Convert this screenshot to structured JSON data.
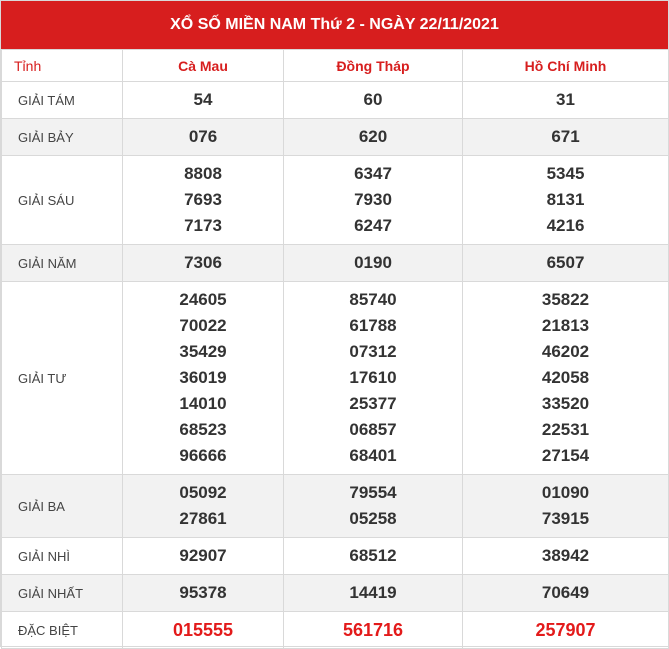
{
  "header": {
    "title": "XỔ SỐ MIỀN NAM Thứ 2 - NGÀY 22/11/2021"
  },
  "table": {
    "corner_label": "Tỉnh",
    "provinces": [
      "Cà Mau",
      "Đồng Tháp",
      "Hồ Chí Minh"
    ],
    "rows": [
      {
        "label": "GIẢI TÁM",
        "values": [
          [
            "54"
          ],
          [
            "60"
          ],
          [
            "31"
          ]
        ]
      },
      {
        "label": "GIẢI BẢY",
        "values": [
          [
            "076"
          ],
          [
            "620"
          ],
          [
            "671"
          ]
        ]
      },
      {
        "label": "GIẢI SÁU",
        "values": [
          [
            "8808",
            "7693",
            "7173"
          ],
          [
            "6347",
            "7930",
            "6247"
          ],
          [
            "5345",
            "8131",
            "4216"
          ]
        ]
      },
      {
        "label": "GIẢI NĂM",
        "values": [
          [
            "7306"
          ],
          [
            "0190"
          ],
          [
            "6507"
          ]
        ]
      },
      {
        "label": "GIẢI TƯ",
        "values": [
          [
            "24605",
            "70022",
            "35429",
            "36019",
            "14010",
            "68523",
            "96666"
          ],
          [
            "85740",
            "61788",
            "07312",
            "17610",
            "25377",
            "06857",
            "68401"
          ],
          [
            "35822",
            "21813",
            "46202",
            "42058",
            "33520",
            "22531",
            "27154"
          ]
        ]
      },
      {
        "label": "GIẢI BA",
        "values": [
          [
            "05092",
            "27861"
          ],
          [
            "79554",
            "05258"
          ],
          [
            "01090",
            "73915"
          ]
        ]
      },
      {
        "label": "GIẢI NHÌ",
        "values": [
          [
            "92907"
          ],
          [
            "68512"
          ],
          [
            "38942"
          ]
        ]
      },
      {
        "label": "GIẢI NHẤT",
        "values": [
          [
            "95378"
          ],
          [
            "14419"
          ],
          [
            "70649"
          ]
        ]
      },
      {
        "label": "ĐẶC BIỆT",
        "values": [
          [
            "015555"
          ],
          [
            "561716"
          ],
          [
            "257907"
          ]
        ]
      }
    ]
  },
  "colors": {
    "header_bg": "#d71e1e",
    "special_prize": "#e31a1a",
    "alt_row_bg": "#f2f2f2"
  }
}
